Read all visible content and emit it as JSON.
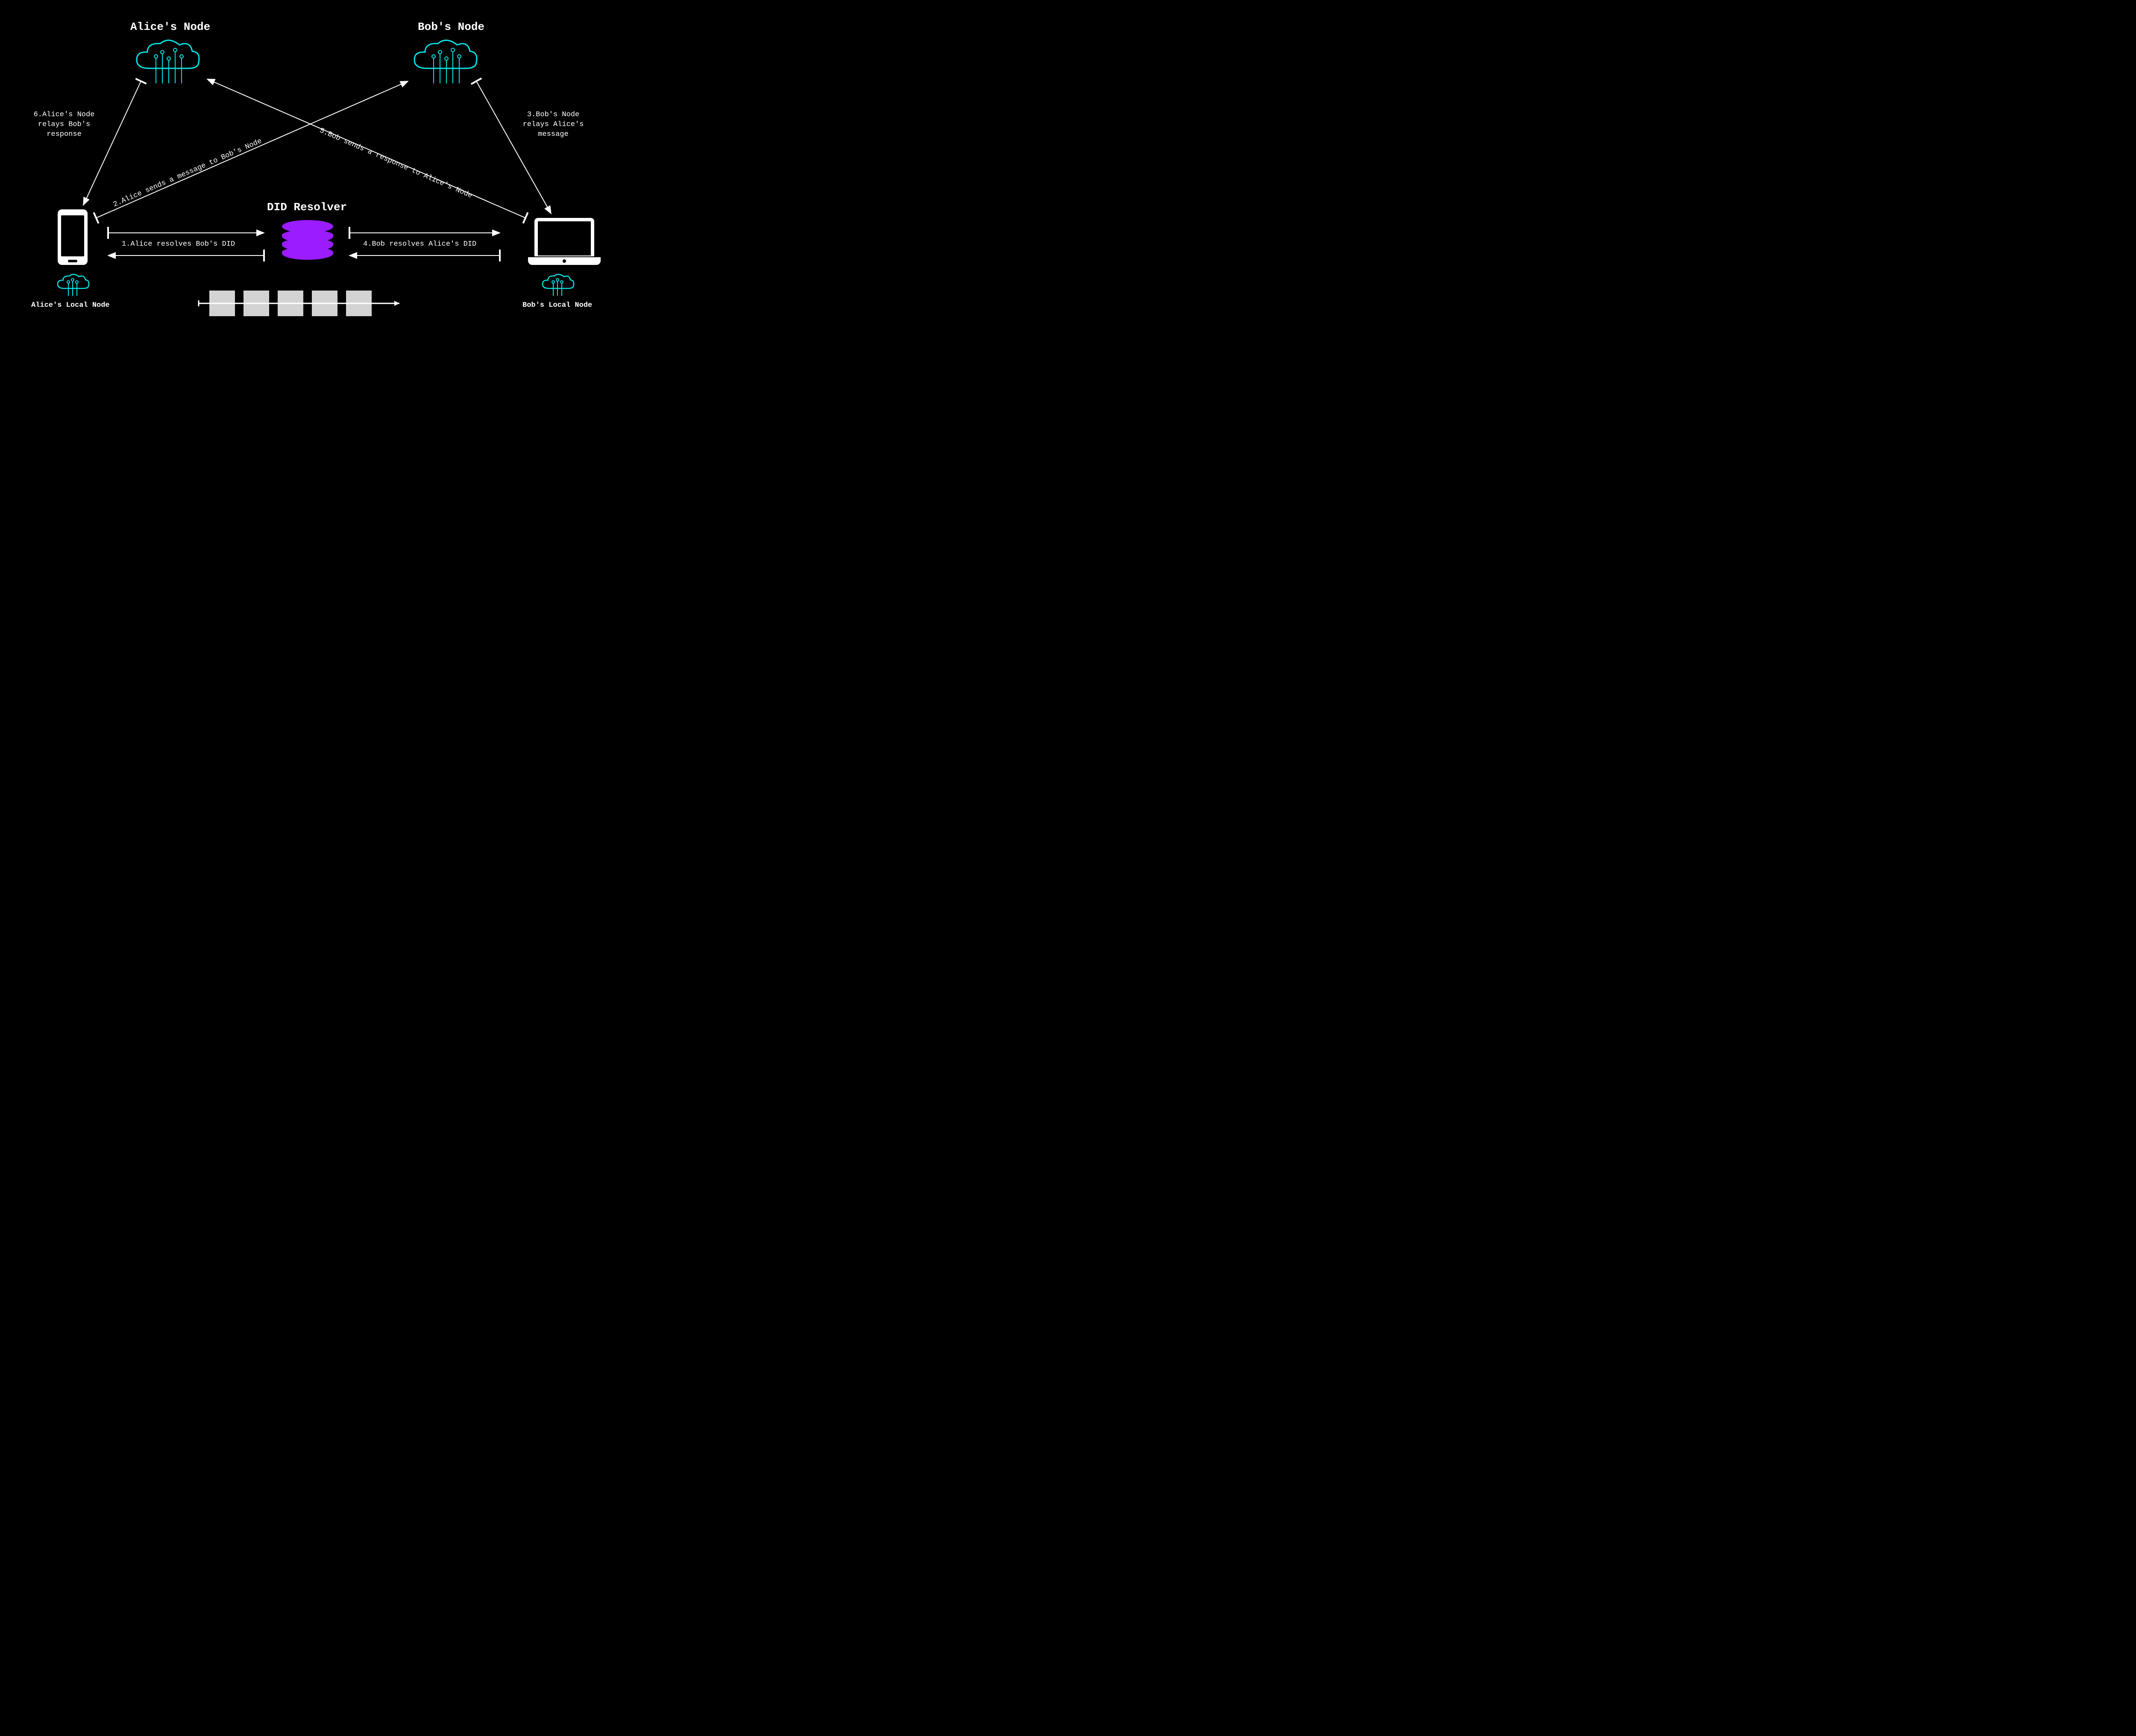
{
  "nodes": {
    "alice_cloud": "Alice's Node",
    "bob_cloud": "Bob's Node",
    "resolver": "DID Resolver",
    "alice_local": "Alice's Local Node",
    "bob_local": "Bob's Local Node"
  },
  "steps": {
    "s1": "1.Alice resolves Bob's DID",
    "s2": "2.Alice sends a message to Bob's Node",
    "s3": "3.Bob's Node relays Alice's message",
    "s4": "4.Bob resolves Alice's DID",
    "s5": "5.Bob sends a response to Alice's Node",
    "s6": "6.Alice's Node relays Bob's response"
  },
  "colors": {
    "accent_cyan": "#00e5e5",
    "accent_purple": "#9a1cff",
    "bg": "#000000",
    "fg": "#ffffff",
    "block": "#d3d3d3"
  }
}
